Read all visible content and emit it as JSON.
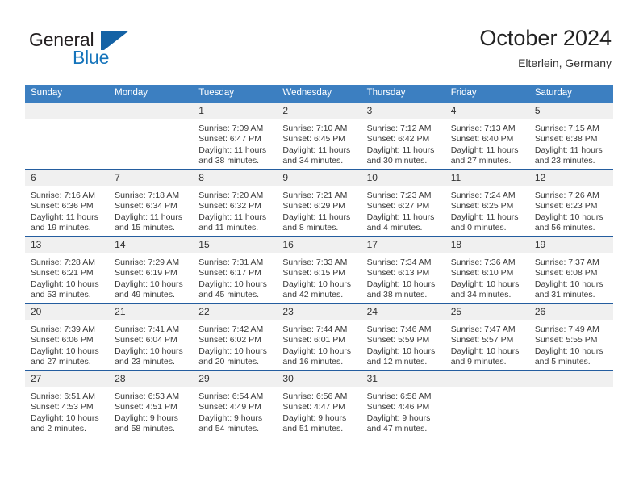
{
  "brand": {
    "name_part1": "General",
    "name_part2": "Blue",
    "mark": "triangle-flag-logo"
  },
  "header": {
    "title": "October 2024",
    "location": "Elterlein, Germany"
  },
  "calendar": {
    "weekday_headers": [
      "Sunday",
      "Monday",
      "Tuesday",
      "Wednesday",
      "Thursday",
      "Friday",
      "Saturday"
    ],
    "colors": {
      "header_background": "#3c7fc1",
      "header_text": "#ffffff",
      "daynum_background": "#f0f0f0",
      "row_separator": "#245d9f",
      "brand_blue": "#1574bb"
    },
    "weeks": [
      [
        {
          "day": "",
          "lines": []
        },
        {
          "day": "",
          "lines": []
        },
        {
          "day": "1",
          "lines": [
            "Sunrise: 7:09 AM",
            "Sunset: 6:47 PM",
            "Daylight: 11 hours",
            "and 38 minutes."
          ]
        },
        {
          "day": "2",
          "lines": [
            "Sunrise: 7:10 AM",
            "Sunset: 6:45 PM",
            "Daylight: 11 hours",
            "and 34 minutes."
          ]
        },
        {
          "day": "3",
          "lines": [
            "Sunrise: 7:12 AM",
            "Sunset: 6:42 PM",
            "Daylight: 11 hours",
            "and 30 minutes."
          ]
        },
        {
          "day": "4",
          "lines": [
            "Sunrise: 7:13 AM",
            "Sunset: 6:40 PM",
            "Daylight: 11 hours",
            "and 27 minutes."
          ]
        },
        {
          "day": "5",
          "lines": [
            "Sunrise: 7:15 AM",
            "Sunset: 6:38 PM",
            "Daylight: 11 hours",
            "and 23 minutes."
          ]
        }
      ],
      [
        {
          "day": "6",
          "lines": [
            "Sunrise: 7:16 AM",
            "Sunset: 6:36 PM",
            "Daylight: 11 hours",
            "and 19 minutes."
          ]
        },
        {
          "day": "7",
          "lines": [
            "Sunrise: 7:18 AM",
            "Sunset: 6:34 PM",
            "Daylight: 11 hours",
            "and 15 minutes."
          ]
        },
        {
          "day": "8",
          "lines": [
            "Sunrise: 7:20 AM",
            "Sunset: 6:32 PM",
            "Daylight: 11 hours",
            "and 11 minutes."
          ]
        },
        {
          "day": "9",
          "lines": [
            "Sunrise: 7:21 AM",
            "Sunset: 6:29 PM",
            "Daylight: 11 hours",
            "and 8 minutes."
          ]
        },
        {
          "day": "10",
          "lines": [
            "Sunrise: 7:23 AM",
            "Sunset: 6:27 PM",
            "Daylight: 11 hours",
            "and 4 minutes."
          ]
        },
        {
          "day": "11",
          "lines": [
            "Sunrise: 7:24 AM",
            "Sunset: 6:25 PM",
            "Daylight: 11 hours",
            "and 0 minutes."
          ]
        },
        {
          "day": "12",
          "lines": [
            "Sunrise: 7:26 AM",
            "Sunset: 6:23 PM",
            "Daylight: 10 hours",
            "and 56 minutes."
          ]
        }
      ],
      [
        {
          "day": "13",
          "lines": [
            "Sunrise: 7:28 AM",
            "Sunset: 6:21 PM",
            "Daylight: 10 hours",
            "and 53 minutes."
          ]
        },
        {
          "day": "14",
          "lines": [
            "Sunrise: 7:29 AM",
            "Sunset: 6:19 PM",
            "Daylight: 10 hours",
            "and 49 minutes."
          ]
        },
        {
          "day": "15",
          "lines": [
            "Sunrise: 7:31 AM",
            "Sunset: 6:17 PM",
            "Daylight: 10 hours",
            "and 45 minutes."
          ]
        },
        {
          "day": "16",
          "lines": [
            "Sunrise: 7:33 AM",
            "Sunset: 6:15 PM",
            "Daylight: 10 hours",
            "and 42 minutes."
          ]
        },
        {
          "day": "17",
          "lines": [
            "Sunrise: 7:34 AM",
            "Sunset: 6:13 PM",
            "Daylight: 10 hours",
            "and 38 minutes."
          ]
        },
        {
          "day": "18",
          "lines": [
            "Sunrise: 7:36 AM",
            "Sunset: 6:10 PM",
            "Daylight: 10 hours",
            "and 34 minutes."
          ]
        },
        {
          "day": "19",
          "lines": [
            "Sunrise: 7:37 AM",
            "Sunset: 6:08 PM",
            "Daylight: 10 hours",
            "and 31 minutes."
          ]
        }
      ],
      [
        {
          "day": "20",
          "lines": [
            "Sunrise: 7:39 AM",
            "Sunset: 6:06 PM",
            "Daylight: 10 hours",
            "and 27 minutes."
          ]
        },
        {
          "day": "21",
          "lines": [
            "Sunrise: 7:41 AM",
            "Sunset: 6:04 PM",
            "Daylight: 10 hours",
            "and 23 minutes."
          ]
        },
        {
          "day": "22",
          "lines": [
            "Sunrise: 7:42 AM",
            "Sunset: 6:02 PM",
            "Daylight: 10 hours",
            "and 20 minutes."
          ]
        },
        {
          "day": "23",
          "lines": [
            "Sunrise: 7:44 AM",
            "Sunset: 6:01 PM",
            "Daylight: 10 hours",
            "and 16 minutes."
          ]
        },
        {
          "day": "24",
          "lines": [
            "Sunrise: 7:46 AM",
            "Sunset: 5:59 PM",
            "Daylight: 10 hours",
            "and 12 minutes."
          ]
        },
        {
          "day": "25",
          "lines": [
            "Sunrise: 7:47 AM",
            "Sunset: 5:57 PM",
            "Daylight: 10 hours",
            "and 9 minutes."
          ]
        },
        {
          "day": "26",
          "lines": [
            "Sunrise: 7:49 AM",
            "Sunset: 5:55 PM",
            "Daylight: 10 hours",
            "and 5 minutes."
          ]
        }
      ],
      [
        {
          "day": "27",
          "lines": [
            "Sunrise: 6:51 AM",
            "Sunset: 4:53 PM",
            "Daylight: 10 hours",
            "and 2 minutes."
          ]
        },
        {
          "day": "28",
          "lines": [
            "Sunrise: 6:53 AM",
            "Sunset: 4:51 PM",
            "Daylight: 9 hours",
            "and 58 minutes."
          ]
        },
        {
          "day": "29",
          "lines": [
            "Sunrise: 6:54 AM",
            "Sunset: 4:49 PM",
            "Daylight: 9 hours",
            "and 54 minutes."
          ]
        },
        {
          "day": "30",
          "lines": [
            "Sunrise: 6:56 AM",
            "Sunset: 4:47 PM",
            "Daylight: 9 hours",
            "and 51 minutes."
          ]
        },
        {
          "day": "31",
          "lines": [
            "Sunrise: 6:58 AM",
            "Sunset: 4:46 PM",
            "Daylight: 9 hours",
            "and 47 minutes."
          ]
        },
        {
          "day": "",
          "lines": []
        },
        {
          "day": "",
          "lines": []
        }
      ]
    ]
  }
}
